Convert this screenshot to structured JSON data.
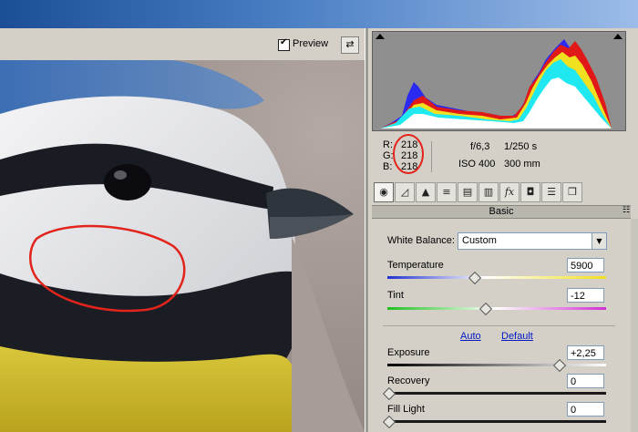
{
  "preview": {
    "label": "Preview",
    "checked": true
  },
  "readout": {
    "r_label": "R:",
    "g_label": "G:",
    "b_label": "B:",
    "r": "218",
    "g": "218",
    "b": "218",
    "aperture": "f/6,3",
    "shutter": "1/250 s",
    "iso": "ISO 400",
    "focal": "300 mm"
  },
  "tools": [
    "basic-tab-icon",
    "tone-curve-icon",
    "detail-icon",
    "hsl-grayscale-icon",
    "split-toning-icon",
    "lens-corrections-icon",
    "effects-icon",
    "camera-calibration-icon",
    "presets-icon",
    "snapshots-icon"
  ],
  "panel": {
    "title": "Basic",
    "white_balance_label": "White Balance:",
    "white_balance_value": "Custom",
    "auto_label": "Auto",
    "default_label": "Default",
    "sliders": [
      {
        "label": "Temperature",
        "value": "5900",
        "level": 0.4
      },
      {
        "label": "Tint",
        "value": "-12",
        "level": 0.45
      },
      {
        "label": "Exposure",
        "value": "+2,25",
        "level": 0.78
      },
      {
        "label": "Recovery",
        "value": "0",
        "level": 0.0
      },
      {
        "label": "Fill Light",
        "value": "0",
        "level": 0.0
      }
    ]
  },
  "colors": {
    "accent_red": "#e2241c",
    "link_blue": "#0019c4"
  }
}
